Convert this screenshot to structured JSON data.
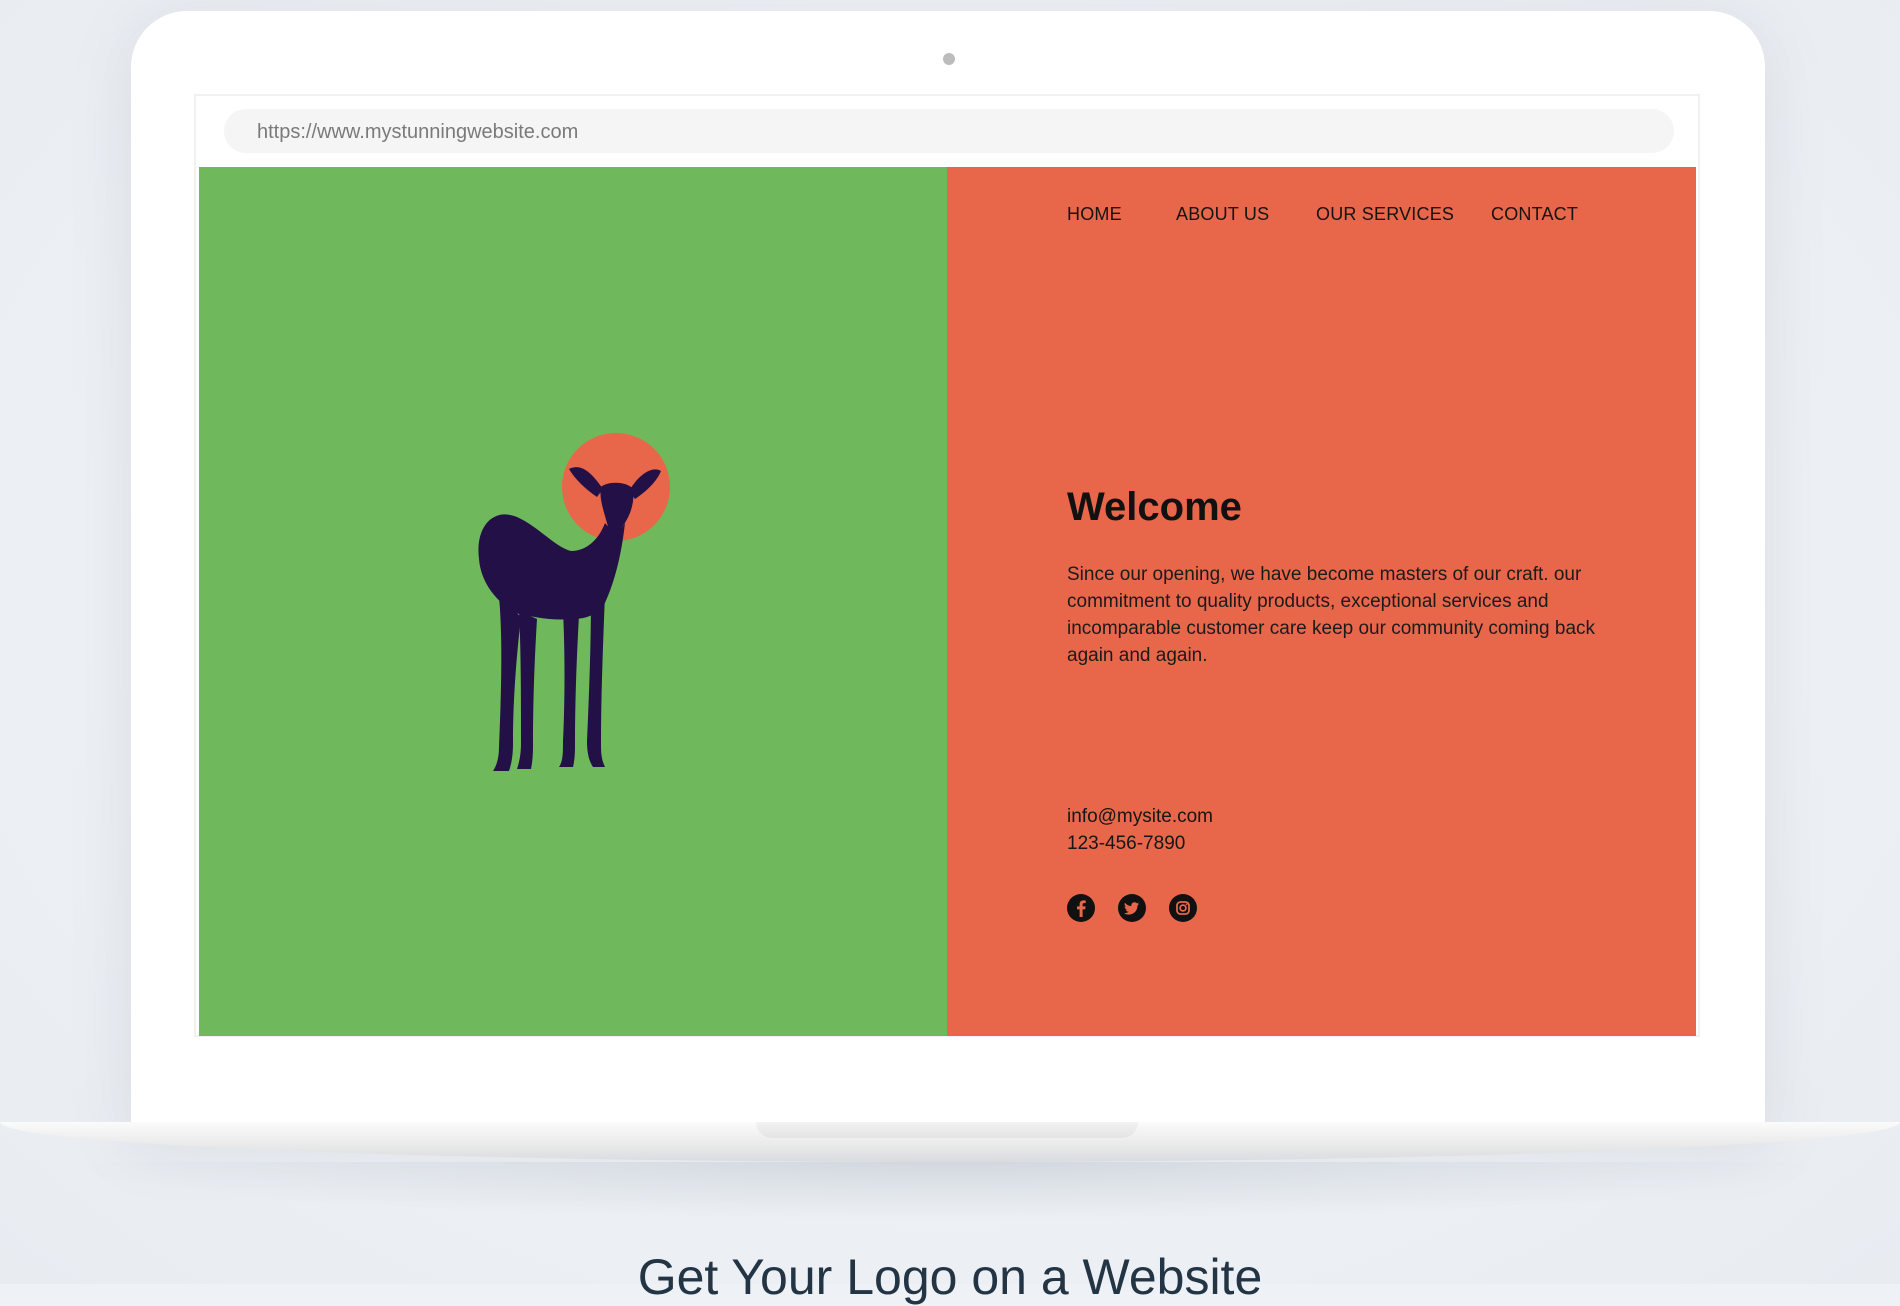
{
  "browser": {
    "url": "https://www.mystunningwebsite.com"
  },
  "site": {
    "colors": {
      "left_panel": "#70b85c",
      "right_panel": "#e8664a",
      "logo_sun": "#e8664a",
      "logo_deer": "#231047"
    },
    "nav": {
      "items": [
        "HOME",
        "ABOUT US",
        "OUR SERVICES",
        "CONTACT"
      ]
    },
    "hero": {
      "title": "Welcome",
      "body": "Since our opening, we have become masters of our craft. our commitment to quality products, exceptional services and incomparable customer care keep our community coming back again and again."
    },
    "contact": {
      "email": "info@mysite.com",
      "phone": "123-456-7890"
    },
    "social_icons": [
      "facebook-icon",
      "twitter-icon",
      "instagram-icon"
    ]
  },
  "caption": "Get Your Logo on a Website"
}
